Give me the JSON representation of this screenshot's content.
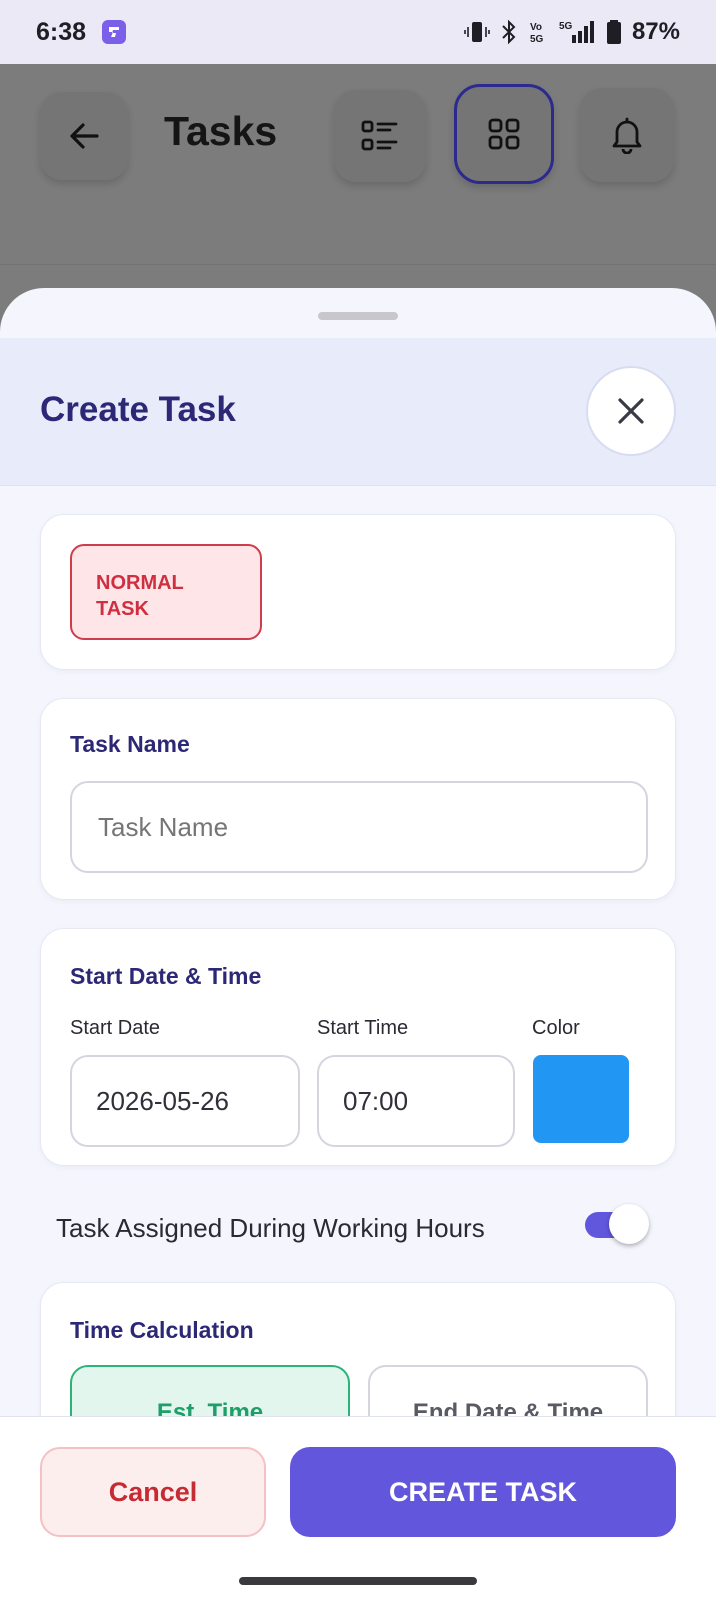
{
  "status_bar": {
    "time": "6:38",
    "battery": "87%",
    "icons": [
      "app-notification-icon",
      "vibrate-icon",
      "bluetooth-icon",
      "volte-icon",
      "5g-signal-icon",
      "battery-icon"
    ]
  },
  "background_app": {
    "title": "Tasks",
    "buttons": [
      "back-arrow-icon",
      "list-view-icon",
      "grid-view-icon",
      "bell-icon"
    ]
  },
  "sheet": {
    "title": "Create Task",
    "close_icon": "close-icon",
    "task_type": "NORMAL\nTASK",
    "task_name": {
      "label": "Task Name",
      "placeholder": "Task Name",
      "value": ""
    },
    "start": {
      "label": "Start Date & Time",
      "date_label": "Start Date",
      "date_value": "2026-05-26",
      "time_label": "Start Time",
      "time_value": "07:00",
      "color_label": "Color",
      "color_value": "#2196F3"
    },
    "working_hours": {
      "label": "Task Assigned During Working Hours",
      "enabled": true
    },
    "time_calc": {
      "label": "Time Calculation",
      "options": [
        "Est. Time",
        "End Date & Time"
      ],
      "selected": "Est. Time"
    }
  },
  "footer": {
    "cancel_label": "Cancel",
    "create_label": "CREATE TASK"
  },
  "colors": {
    "primary": "#6257DC",
    "heading": "#2D2876",
    "danger": "#CF2F40",
    "success": "#2BB37B"
  }
}
